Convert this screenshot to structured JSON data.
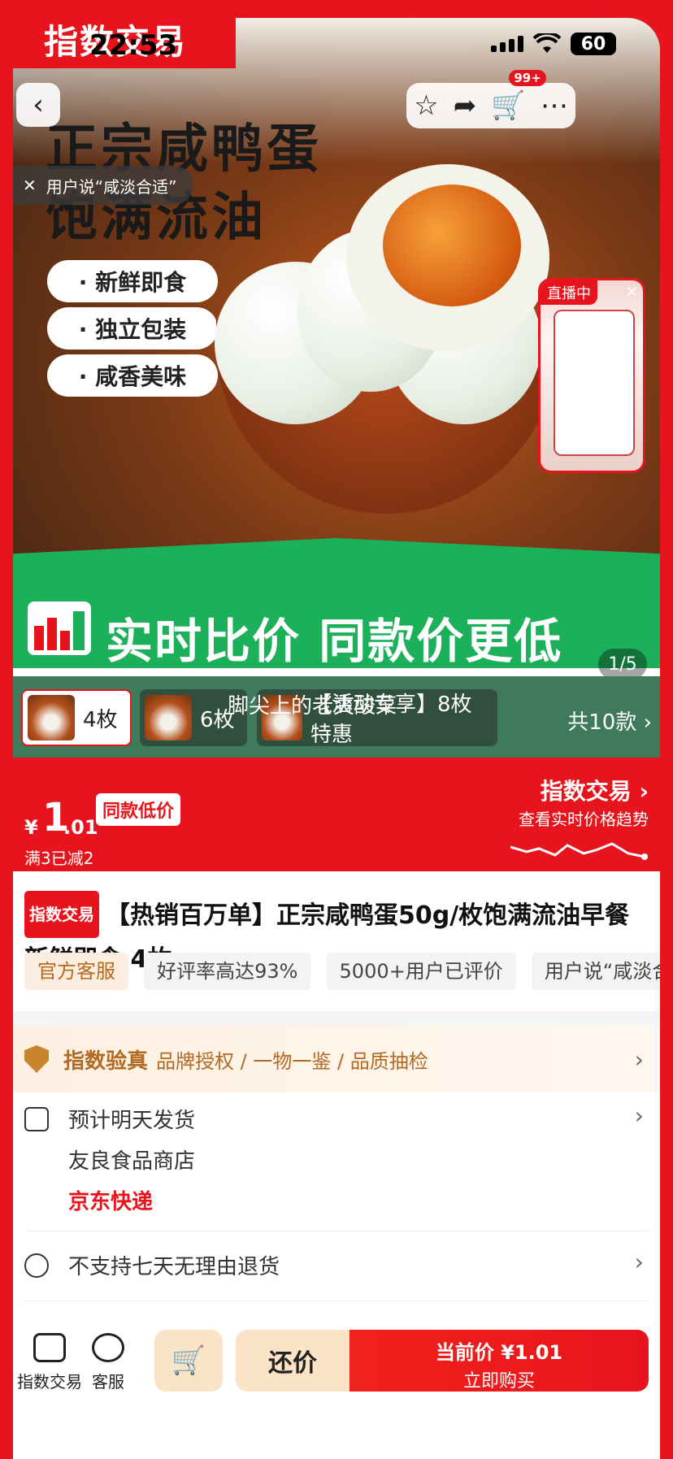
{
  "frame": {
    "brand_label": "指数交易"
  },
  "status": {
    "time": "22:53",
    "battery": "60"
  },
  "hero": {
    "title_line1": "正宗咸鸭蛋",
    "title_line2": "饱满流油",
    "tags": [
      "· 新鲜即食",
      "· 独立包装",
      "· 咸香美味"
    ],
    "user_says": "用户说“咸淡合适”",
    "cart_badge": "99+",
    "live_label": "直播中"
  },
  "compare_banner": {
    "text": "实时比价 同款价更低",
    "counter": "1/5"
  },
  "variants": {
    "items": [
      {
        "label": "4枚",
        "selected": true
      },
      {
        "label": "6枚",
        "selected": false
      },
      {
        "label": "【活动专享】8枚特惠",
        "selected": false
      }
    ],
    "overlay_caption": "脚尖上的老爽酸菜",
    "total": "共10款 ›"
  },
  "price": {
    "currency": "¥",
    "integer": "1",
    "decimal": ".01",
    "low_tag": "同款低价",
    "promo": "满3已减2",
    "brand_link": "指数交易 ›",
    "trend_link": "查看实时价格趋势"
  },
  "product": {
    "badge": "指数交易",
    "title": "【热销百万单】正宗咸鸭蛋50g/枚饱满流油早餐新鲜即食 4枚",
    "chips": [
      "官方客服",
      "好评率高达93%",
      "5000+用户已评价",
      "用户说“咸淡合"
    ]
  },
  "verify": {
    "title": "指数验真",
    "items": "品牌授权 / 一物一鉴 / 品质抽检"
  },
  "shipping": {
    "eta": "预计明天发货",
    "store": "友良食品商店",
    "carrier": "京东快递"
  },
  "returns": {
    "text": "不支持七天无理由退货"
  },
  "bottom": {
    "home_label": "指数交易",
    "service_label": "客服",
    "bargain_label": "还价",
    "buy_line1": "当前价 ¥1.01",
    "buy_line2": "立即购买"
  },
  "colors": {
    "brand_red": "#e8141d",
    "compare_green": "#1cb05a",
    "gold": "#b36a22"
  }
}
